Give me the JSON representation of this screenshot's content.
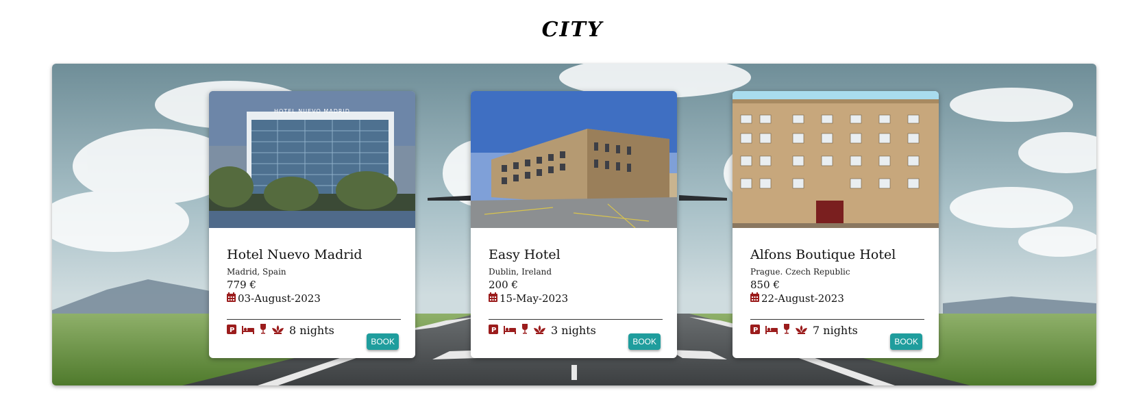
{
  "page": {
    "title": "CITY"
  },
  "colors": {
    "accent": "#1f9d9d",
    "icon_red": "#9b1c1c"
  },
  "hotels": [
    {
      "name": "Hotel Nuevo Madrid",
      "location": "Madrid, Spain",
      "price": "779 €",
      "date": "03-August-2023",
      "nights": "8 nights",
      "book": "BOOK",
      "photo_sign": "HOTEL NUEVO MADRID",
      "icons": [
        "parking-icon",
        "bed-icon",
        "wine-glass-icon",
        "spa-icon"
      ]
    },
    {
      "name": "Easy Hotel",
      "location": "Dublin, Ireland",
      "price": "200 €",
      "date": "15-May-2023",
      "nights": "3 nights",
      "book": "BOOK",
      "icons": [
        "parking-icon",
        "bed-icon",
        "wine-glass-icon",
        "spa-icon"
      ]
    },
    {
      "name": "Alfons Boutique Hotel",
      "location": "Prague. Czech Republic",
      "price": "850 €",
      "date": "22-August-2023",
      "nights": "7 nights",
      "book": "BOOK",
      "icons": [
        "parking-icon",
        "bed-icon",
        "wine-glass-icon",
        "spa-icon"
      ]
    }
  ]
}
